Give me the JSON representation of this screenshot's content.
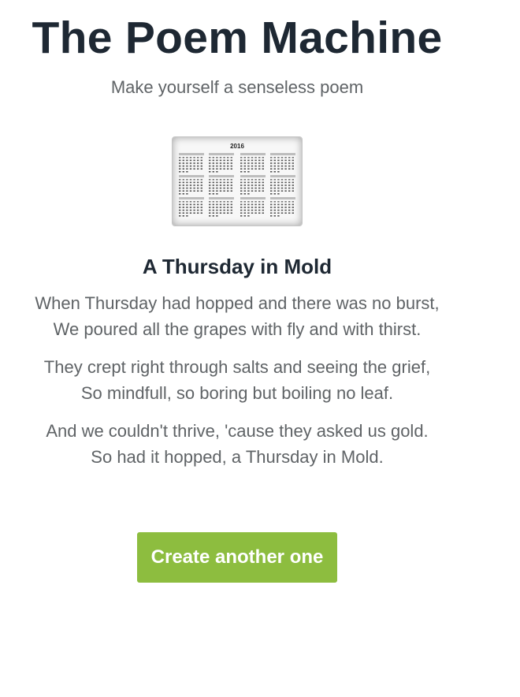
{
  "header": {
    "title": "The Poem Machine",
    "subtitle": "Make yourself a senseless poem"
  },
  "illustration": {
    "icon": "calendar-2016-icon",
    "year_label": "2016"
  },
  "poem": {
    "title": "A Thursday in Mold",
    "stanzas": [
      {
        "lines": [
          "When Thursday had hopped and there was no burst,",
          "We poured all the grapes with fly and with thirst."
        ]
      },
      {
        "lines": [
          "They crept right through salts and seeing the grief,",
          "So mindfull, so boring but boiling no leaf."
        ]
      },
      {
        "lines": [
          "And we couldn't thrive, 'cause they asked us gold.",
          "So had it hopped, a Thursday in Mold."
        ]
      }
    ]
  },
  "actions": {
    "create_label": "Create another one"
  },
  "colors": {
    "title": "#1e2833",
    "body_text": "#5f6366",
    "button_bg": "#8dbd3f",
    "button_text": "#ffffff"
  }
}
